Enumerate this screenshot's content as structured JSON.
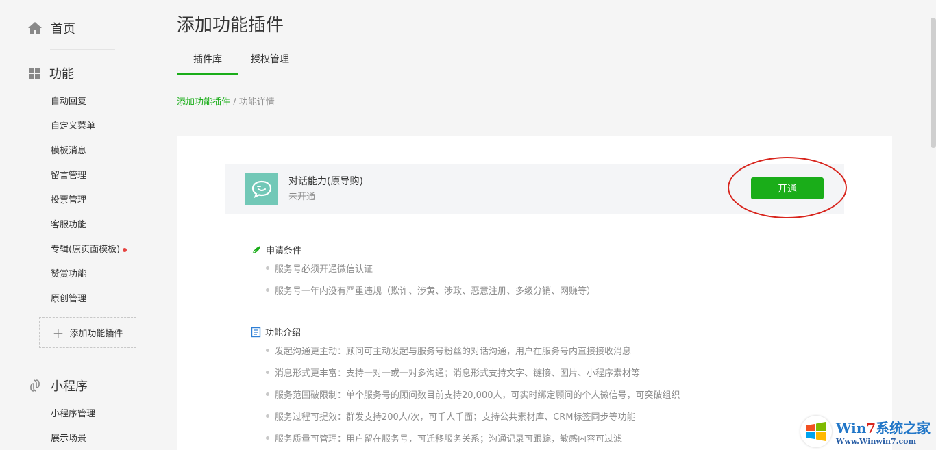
{
  "sidebar": {
    "home": {
      "label": "首页",
      "icon": "home-icon"
    },
    "features": {
      "label": "功能",
      "icon": "grid-icon",
      "items": [
        {
          "label": "自动回复"
        },
        {
          "label": "自定义菜单"
        },
        {
          "label": "模板消息"
        },
        {
          "label": "留言管理"
        },
        {
          "label": "投票管理"
        },
        {
          "label": "客服功能"
        },
        {
          "label": "专辑(原页面模板)",
          "badge": "red-dot"
        },
        {
          "label": "赞赏功能"
        },
        {
          "label": "原创管理"
        }
      ],
      "add_plugin_label": "添加功能插件"
    },
    "miniprogram": {
      "label": "小程序",
      "icon": "link-icon",
      "items": [
        {
          "label": "小程序管理"
        },
        {
          "label": "展示场景"
        }
      ]
    }
  },
  "main": {
    "title": "添加功能插件",
    "tabs": [
      {
        "label": "插件库",
        "active": true
      },
      {
        "label": "授权管理",
        "active": false
      }
    ],
    "breadcrumb": {
      "link": "添加功能插件",
      "separator": "/",
      "current": "功能详情"
    },
    "plugin": {
      "name": "对话能力(原导购)",
      "status": "未开通",
      "button_label": "开通",
      "icon": "chat-bubble-icon",
      "icon_color": "#72c8b7"
    },
    "requirements": {
      "title": "申请条件",
      "icon": "leaf-icon",
      "items": [
        "服务号必须开通微信认证",
        "服务号一年内没有严重违规（欺诈、涉黄、涉政、恶意注册、多级分销、网赚等）"
      ]
    },
    "intro": {
      "title": "功能介绍",
      "icon": "document-icon",
      "items": [
        "发起沟通更主动：顾问可主动发起与服务号粉丝的对话沟通，用户在服务号内直接接收消息",
        "消息形式更丰富：支持一对一或一对多沟通；消息形式支持文字、链接、图片、小程序素材等",
        "服务范围破限制：单个服务号的顾问数目前支持20,000人，可实时绑定顾问的个人微信号，可突破组织",
        "服务过程可提效：群发支持200人/次，可千人千面；支持公共素材库、CRM标签同步等功能",
        "服务质量可管理：用户留在服务号，可迁移服务关系；沟通记录可跟踪，敏感内容可过滤"
      ]
    }
  },
  "watermark": {
    "brand_pre": "Win",
    "brand_num": "7",
    "brand_post": "系统之家",
    "url": "Www.Winwin7.com"
  },
  "colors": {
    "accent": "#1aad19",
    "highlight": "#d8251d",
    "muted": "#8d8d8d"
  }
}
